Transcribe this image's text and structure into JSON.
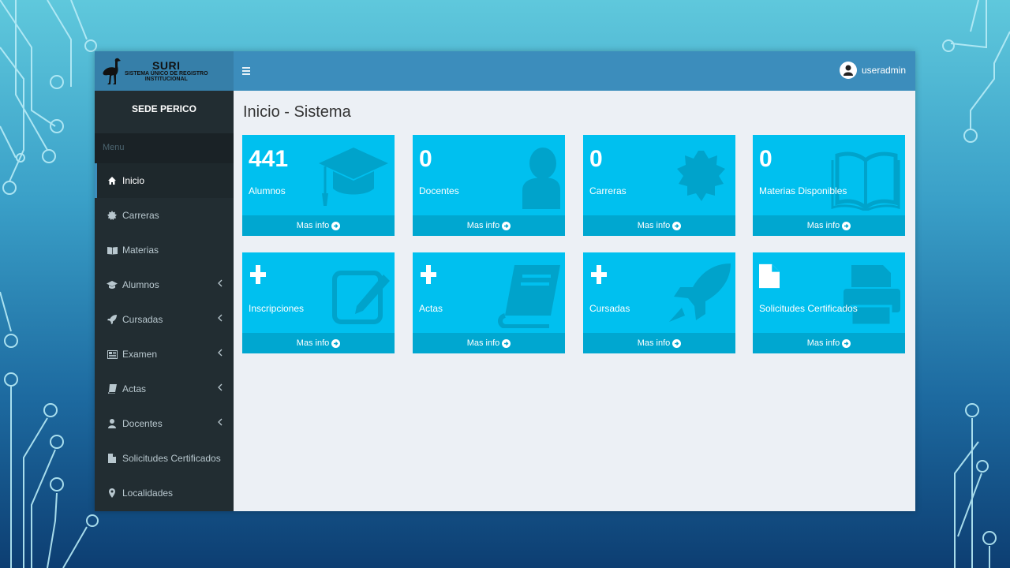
{
  "brand": {
    "title": "SURI",
    "subtitle_line1": "SISTEMA ÚNICO DE REGISTRO",
    "subtitle_line2": "INSTITUCIONAL",
    "logo_icon": "ostrich-icon"
  },
  "sidebar": {
    "sede": "SEDE PERICO",
    "menu_header": "Menu",
    "items": [
      {
        "label": "Inicio",
        "icon": "home-icon",
        "active": true,
        "has_submenu": false
      },
      {
        "label": "Carreras",
        "icon": "certificate-icon",
        "active": false,
        "has_submenu": false
      },
      {
        "label": "Materias",
        "icon": "book-open-icon",
        "active": false,
        "has_submenu": false
      },
      {
        "label": "Alumnos",
        "icon": "graduation-cap-icon",
        "active": false,
        "has_submenu": true
      },
      {
        "label": "Cursadas",
        "icon": "rocket-icon",
        "active": false,
        "has_submenu": true
      },
      {
        "label": "Examen",
        "icon": "newspaper-icon",
        "active": false,
        "has_submenu": true
      },
      {
        "label": "Actas",
        "icon": "book-icon",
        "active": false,
        "has_submenu": true
      },
      {
        "label": "Docentes",
        "icon": "user-icon",
        "active": false,
        "has_submenu": true
      },
      {
        "label": "Solicitudes Certificados",
        "icon": "file-icon",
        "active": false,
        "has_submenu": false
      },
      {
        "label": "Localidades",
        "icon": "map-marker-icon",
        "active": false,
        "has_submenu": false
      }
    ]
  },
  "header": {
    "username": "useradmin"
  },
  "main": {
    "title": "Inicio - Sistema",
    "boxes": [
      {
        "value": "441",
        "label": "Alumnos",
        "link": "Mas info",
        "icon": "graduation-cap-icon"
      },
      {
        "value": "0",
        "label": "Docentes",
        "link": "Mas info",
        "icon": "user-icon"
      },
      {
        "value": "0",
        "label": "Carreras",
        "link": "Mas info",
        "icon": "certificate-icon"
      },
      {
        "value": "0",
        "label": "Materias Disponibles",
        "link": "Mas info",
        "icon": "book-open-icon"
      },
      {
        "value": "",
        "label": "Inscripciones",
        "link": "Mas info",
        "icon": "edit-icon",
        "lead_icon": "plus-icon"
      },
      {
        "value": "",
        "label": "Actas",
        "link": "Mas info",
        "icon": "book-icon",
        "lead_icon": "plus-icon"
      },
      {
        "value": "",
        "label": "Cursadas",
        "link": "Mas info",
        "icon": "rocket-icon",
        "lead_icon": "plus-icon"
      },
      {
        "value": "",
        "label": "Solicitudes Certificados",
        "link": "Mas info",
        "icon": "print-icon",
        "lead_icon": "file-icon"
      }
    ]
  },
  "colors": {
    "header": "#3c8dbc",
    "logo_bg": "#367fa9",
    "sidebar": "#222d32",
    "box": "#00c0ef",
    "box_footer": "#00a7d0",
    "content_bg": "#ecf0f5"
  }
}
